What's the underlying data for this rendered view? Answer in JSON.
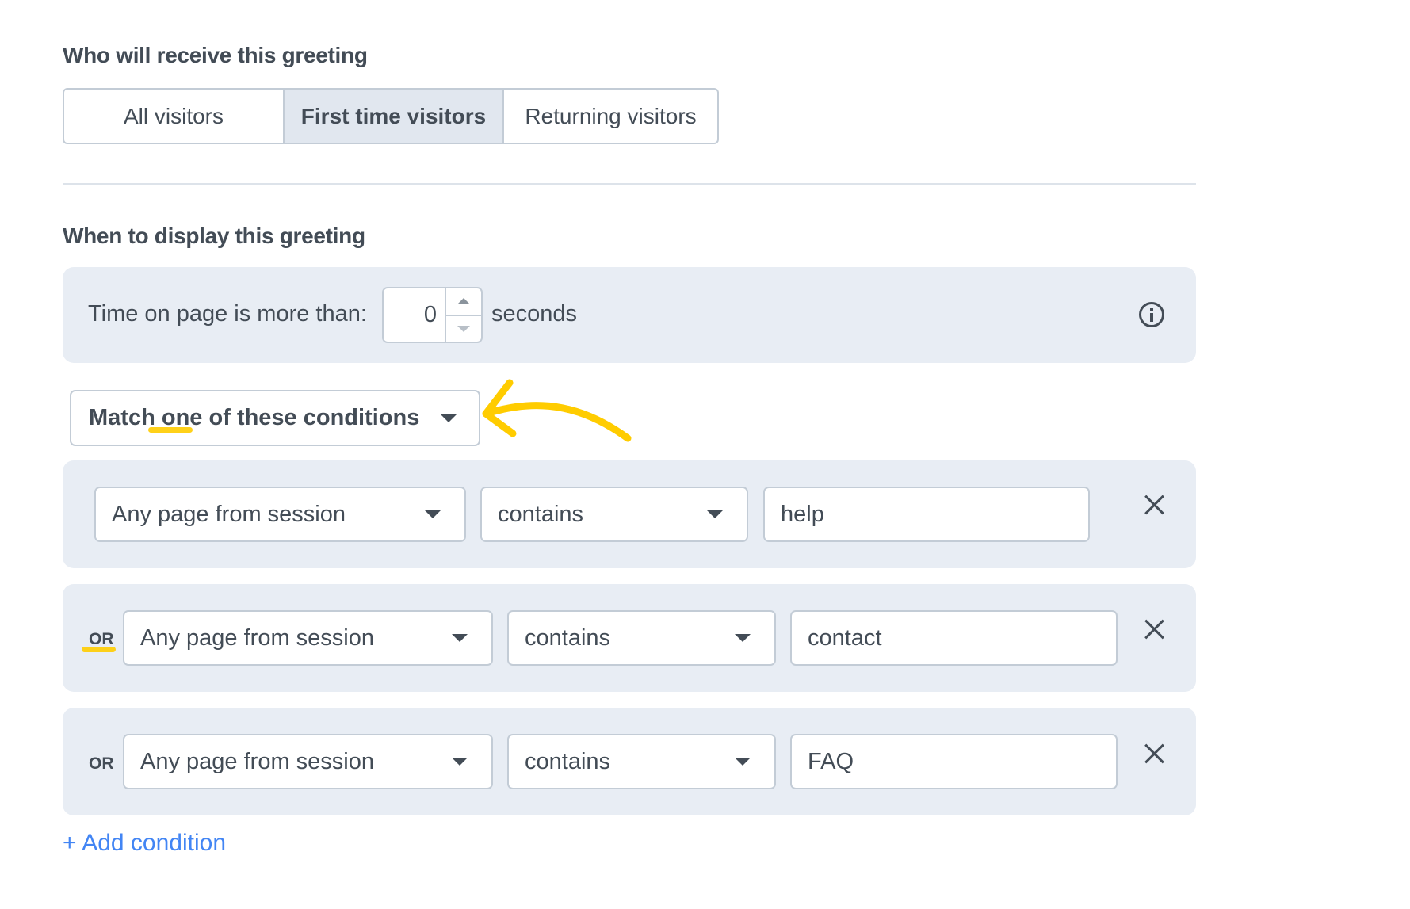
{
  "recipients": {
    "title": "Who will receive this greeting",
    "options": [
      {
        "label": "All visitors",
        "selected": false
      },
      {
        "label": "First time visitors",
        "selected": true
      },
      {
        "label": "Returning visitors",
        "selected": false
      }
    ]
  },
  "display": {
    "title": "When to display this greeting",
    "time_on_page": {
      "label": "Time on page is more than:",
      "value": "0",
      "unit": "seconds",
      "icon": "info-icon"
    },
    "match_mode": {
      "prefix": "Match",
      "emphasis": "one",
      "suffix": "of these conditions",
      "icon": "caret-down-icon"
    },
    "conditions": [
      {
        "connector": "",
        "scope": "Any page from session",
        "operator": "contains",
        "value": "help",
        "remove_icon": "close-icon"
      },
      {
        "connector": "OR",
        "scope": "Any page from session",
        "operator": "contains",
        "value": "contact",
        "remove_icon": "close-icon"
      },
      {
        "connector": "OR",
        "scope": "Any page from session",
        "operator": "contains",
        "value": "FAQ",
        "remove_icon": "close-icon"
      }
    ],
    "add_condition_label": "+ Add condition"
  },
  "annotation": {
    "color": "#FFCC00",
    "arrow_icon": "curved-arrow-icon"
  }
}
